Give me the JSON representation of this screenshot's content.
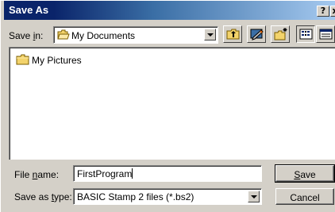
{
  "window": {
    "title": "Save As",
    "help_button": "?",
    "close_button": "x"
  },
  "save_in": {
    "label_pre": "Save ",
    "label_accel": "i",
    "label_post": "n:",
    "value": "My Documents",
    "icon": "open-folder-icon"
  },
  "toolbar": {
    "buttons": [
      "up-one-level-icon",
      "desktop-icon",
      "new-folder-icon",
      "list-view-icon",
      "details-view-icon"
    ]
  },
  "file_list": {
    "items": [
      {
        "label": "My Pictures",
        "icon": "folder-icon"
      }
    ]
  },
  "file_name": {
    "label_pre": "File ",
    "label_accel": "n",
    "label_post": "ame:",
    "value": "FirstProgram"
  },
  "save_as_type": {
    "label_pre": "Save as ",
    "label_accel": "t",
    "label_post": "ype:",
    "value": "BASIC Stamp 2 files (*.bs2)"
  },
  "buttons": {
    "save_accel": "S",
    "save_rest": "ave",
    "cancel": "Cancel"
  },
  "colors": {
    "title_bar": "#0a246a",
    "dialog_face": "#d4d0c8",
    "folder_yellow": "#f3d36b"
  }
}
